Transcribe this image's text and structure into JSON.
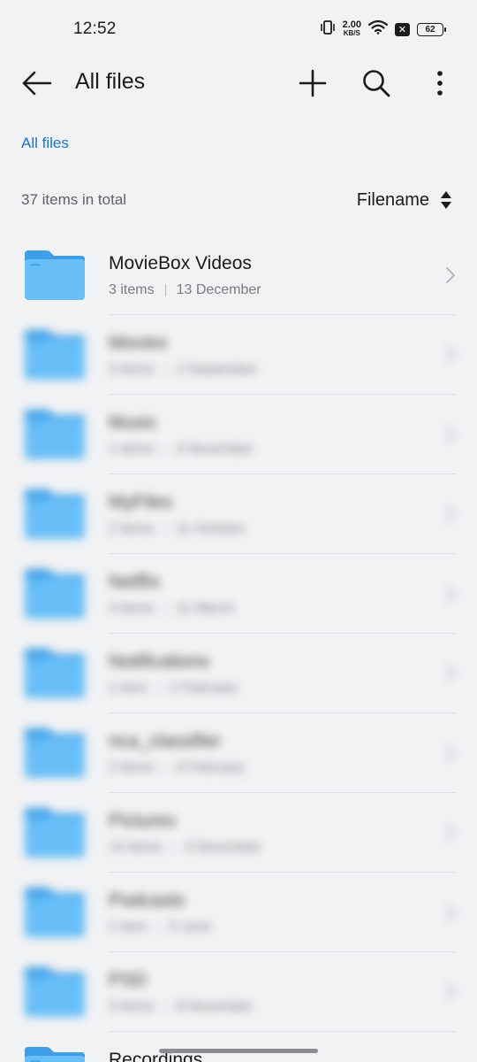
{
  "status_bar": {
    "time": "12:52",
    "net_speed_value": "2.00",
    "net_speed_unit": "KB/S",
    "battery": "62",
    "icons": [
      "vibrate-icon",
      "wifi-icon",
      "no-sim-icon",
      "battery-icon"
    ]
  },
  "app_bar": {
    "title": "All files",
    "actions": [
      "back-arrow-icon",
      "plus-icon",
      "search-icon",
      "more-vert-icon"
    ]
  },
  "breadcrumb": "All files",
  "summary": {
    "count_text": "37 items in total",
    "sort_label": "Filename"
  },
  "files": [
    {
      "name": "MovieBox Videos",
      "items": "3 items",
      "date": "13 December",
      "blurred": false
    },
    {
      "name": "Movies",
      "items": "3 items",
      "date": "2 September",
      "blurred": true
    },
    {
      "name": "Music",
      "items": "1 items",
      "date": "4 November",
      "blurred": true
    },
    {
      "name": "MyFiles",
      "items": "2 items",
      "date": "11 October",
      "blurred": true
    },
    {
      "name": "Netflix",
      "items": "4 items",
      "date": "11 March",
      "blurred": true
    },
    {
      "name": "Notifications",
      "items": "1 item",
      "date": "1 February",
      "blurred": true
    },
    {
      "name": "nca_classifier",
      "items": "2 items",
      "date": "9 February",
      "blurred": true
    },
    {
      "name": "Pictures",
      "items": "14 items",
      "date": "3 December",
      "blurred": true
    },
    {
      "name": "Podcasts",
      "items": "1 item",
      "date": "5 June",
      "blurred": true
    },
    {
      "name": "PSD",
      "items": "3 items",
      "date": "8 November",
      "blurred": true
    },
    {
      "name": "Recordings",
      "items": "",
      "date": "",
      "blurred": false
    }
  ],
  "colors": {
    "accent": "#1a73d9",
    "background": "#f1f2f4",
    "folder": "#68bff7"
  }
}
